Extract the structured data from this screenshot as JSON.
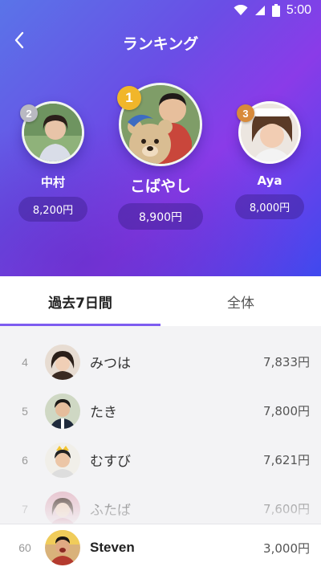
{
  "status_bar": {
    "time": "5:00"
  },
  "header": {
    "title": "ランキング",
    "back_icon": "chevron-left-icon"
  },
  "top_three": [
    {
      "rank": "1",
      "name": "こばやし",
      "amount": "8,900円",
      "medal_color": "#f1b62a"
    },
    {
      "rank": "2",
      "name": "中村",
      "amount": "8,200円",
      "medal_color": "#b9b9c2"
    },
    {
      "rank": "3",
      "name": "Aya",
      "amount": "8,000円",
      "medal_color": "#d88a3a"
    }
  ],
  "tabs": [
    {
      "label": "過去7日間",
      "active": true
    },
    {
      "label": "全体",
      "active": false
    }
  ],
  "ranking_list": [
    {
      "rank": "4",
      "name": "みつは",
      "amount": "7,833円"
    },
    {
      "rank": "5",
      "name": "たき",
      "amount": "7,800円"
    },
    {
      "rank": "6",
      "name": "むすび",
      "amount": "7,621円"
    },
    {
      "rank": "7",
      "name": "ふたば",
      "amount": "7,600円"
    }
  ],
  "my_rank": {
    "rank": "60",
    "name": "Steven",
    "amount": "3,000円"
  },
  "colors": {
    "accent": "#7d5cf0",
    "gradient_start": "#5a74e8",
    "gradient_end": "#3f49ee"
  }
}
